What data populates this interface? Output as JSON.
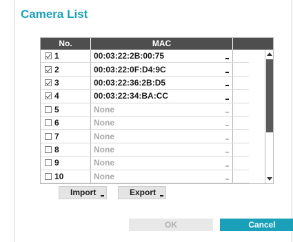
{
  "dialog": {
    "title": "Camera List",
    "accent_color": "#1aa0b8"
  },
  "table": {
    "headers": {
      "no": "No.",
      "mac": "MAC",
      "extra": ""
    },
    "rows": [
      {
        "no": "1",
        "checked": true,
        "mac": "00:03:22:2B:00:75"
      },
      {
        "no": "2",
        "checked": true,
        "mac": "00:03:22:0F:D4:9C"
      },
      {
        "no": "3",
        "checked": true,
        "mac": "00:03:22:36:2B:D5"
      },
      {
        "no": "4",
        "checked": true,
        "mac": "00:03:22:34:BA:CC"
      },
      {
        "no": "5",
        "checked": false,
        "mac": "None"
      },
      {
        "no": "6",
        "checked": false,
        "mac": "None"
      },
      {
        "no": "7",
        "checked": false,
        "mac": "None"
      },
      {
        "no": "8",
        "checked": false,
        "mac": "None"
      },
      {
        "no": "9",
        "checked": false,
        "mac": "None"
      },
      {
        "no": "10",
        "checked": false,
        "mac": "None"
      }
    ]
  },
  "buttons": {
    "import": "Import",
    "export": "Export",
    "ok": "OK",
    "cancel": "Cancel"
  },
  "icons": {
    "scroll_up": "triangle-up-icon",
    "scroll_down": "triangle-down-icon",
    "checkbox": "check-icon"
  }
}
